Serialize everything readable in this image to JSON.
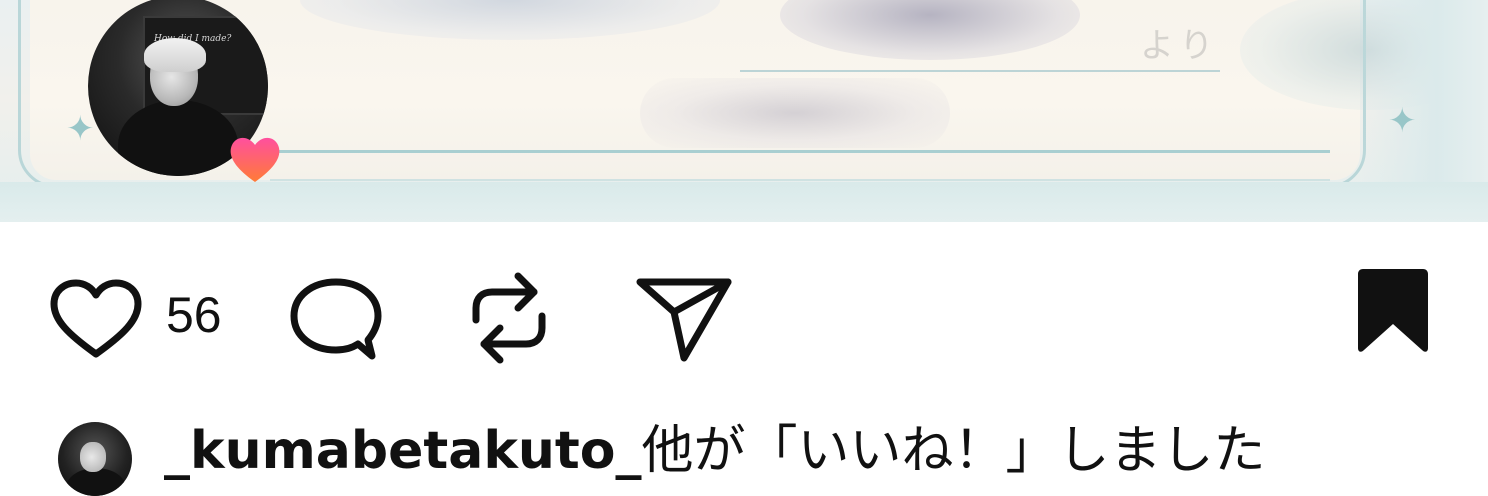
{
  "post": {
    "media": {
      "description_icon": "post-image",
      "overlay_text": "より"
    },
    "author_avatar": {
      "name": "profile-avatar",
      "board_text": "How did I made?",
      "badge_icon": "heart-icon"
    }
  },
  "actions": {
    "like_icon": "heart-outline-icon",
    "like_count": "56",
    "comment_icon": "comment-icon",
    "repost_icon": "repost-icon",
    "share_icon": "send-icon",
    "save_icon": "bookmark-filled-icon"
  },
  "liked_by": {
    "username": "_kumabetakuto_",
    "suffix": "他が「いいね！」しました"
  },
  "colors": {
    "text": "#111111",
    "frame": "#b9d6d8",
    "heart_badge_top": "#ff5a9a",
    "heart_badge_bottom": "#ff7a3c"
  }
}
